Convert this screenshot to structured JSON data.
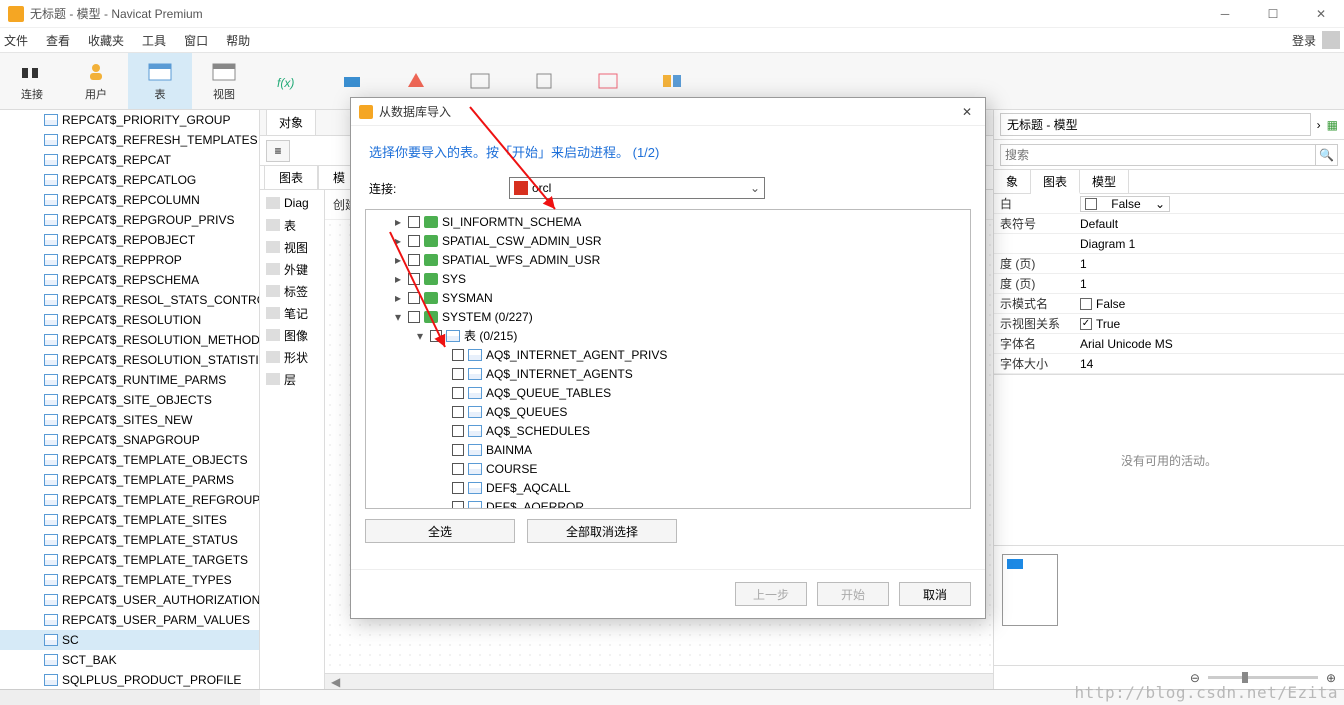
{
  "window": {
    "title": "无标题 - 模型 - Navicat Premium"
  },
  "menu": {
    "items": [
      "文件",
      "查看",
      "收藏夹",
      "工具",
      "窗口",
      "帮助"
    ],
    "login": "登录"
  },
  "toolbar": {
    "items": [
      "连接",
      "用户",
      "表",
      "视图"
    ],
    "activeIndex": 2
  },
  "leftTables": [
    "REPCAT$_PRIORITY_GROUP",
    "REPCAT$_REFRESH_TEMPLATES",
    "REPCAT$_REPCAT",
    "REPCAT$_REPCATLOG",
    "REPCAT$_REPCOLUMN",
    "REPCAT$_REPGROUP_PRIVS",
    "REPCAT$_REPOBJECT",
    "REPCAT$_REPPROP",
    "REPCAT$_REPSCHEMA",
    "REPCAT$_RESOL_STATS_CONTROL",
    "REPCAT$_RESOLUTION",
    "REPCAT$_RESOLUTION_METHOD",
    "REPCAT$_RESOLUTION_STATISTICS",
    "REPCAT$_RUNTIME_PARMS",
    "REPCAT$_SITE_OBJECTS",
    "REPCAT$_SITES_NEW",
    "REPCAT$_SNAPGROUP",
    "REPCAT$_TEMPLATE_OBJECTS",
    "REPCAT$_TEMPLATE_PARMS",
    "REPCAT$_TEMPLATE_REFGROUPS",
    "REPCAT$_TEMPLATE_SITES",
    "REPCAT$_TEMPLATE_STATUS",
    "REPCAT$_TEMPLATE_TARGETS",
    "REPCAT$_TEMPLATE_TYPES",
    "REPCAT$_USER_AUTHORIZATIONS",
    "REPCAT$_USER_PARM_VALUES",
    "SC",
    "SCT_BAK",
    "SQLPLUS_PRODUCT_PROFILE"
  ],
  "leftSelected": "SC",
  "centerTabs1": [
    "对象"
  ],
  "centerTabs2": [
    "图表",
    "模"
  ],
  "navItems": [
    "Diag",
    "表",
    "视图",
    "外键",
    "标签",
    "笔记",
    "图像",
    "形状",
    "层"
  ],
  "createModel": "创建模型",
  "right": {
    "docTitle": "无标题 - 模型",
    "searchPlaceholder": "搜索",
    "tabs": {
      "chart": "图表",
      "model": "模型",
      "left": "象"
    },
    "props": [
      {
        "k": "白",
        "v": "False",
        "dd": true
      },
      {
        "k": "表符号",
        "v": "Default"
      },
      {
        "k": "",
        "v": "Diagram 1"
      },
      {
        "k": "度 (页)",
        "v": "1"
      },
      {
        "k": "度 (页)",
        "v": "1"
      },
      {
        "k": "示模式名",
        "v": "False",
        "chk": false
      },
      {
        "k": "示视图关系",
        "v": "True",
        "chk": true
      },
      {
        "k": "字体名",
        "v": "Arial Unicode MS"
      },
      {
        "k": "字体大小",
        "v": "14"
      }
    ],
    "noActivity": "没有可用的活动。"
  },
  "dialog": {
    "title": "从数据库导入",
    "headline": "选择你要导入的表。按「开始」来启动进程。  (1/2)",
    "connLabel": "连接:",
    "connValue": "orcl",
    "schemas": [
      {
        "name": "SI_INFORMTN_SCHEMA"
      },
      {
        "name": "SPATIAL_CSW_ADMIN_USR"
      },
      {
        "name": "SPATIAL_WFS_ADMIN_USR"
      },
      {
        "name": "SYS"
      },
      {
        "name": "SYSMAN"
      }
    ],
    "systemLabel": "SYSTEM (0/227)",
    "tablesLabel": "表 (0/215)",
    "tables": [
      "AQ$_INTERNET_AGENT_PRIVS",
      "AQ$_INTERNET_AGENTS",
      "AQ$_QUEUE_TABLES",
      "AQ$_QUEUES",
      "AQ$_SCHEDULES",
      "BAINMA",
      "COURSE",
      "DEF$_AQCALL",
      "DEF$_AQERROR"
    ],
    "btnSelectAll": "全选",
    "btnDeselectAll": "全部取消选择",
    "btnPrev": "上一步",
    "btnStart": "开始",
    "btnCancel": "取消"
  },
  "watermark": "http://blog.csdn.net/Ezita"
}
